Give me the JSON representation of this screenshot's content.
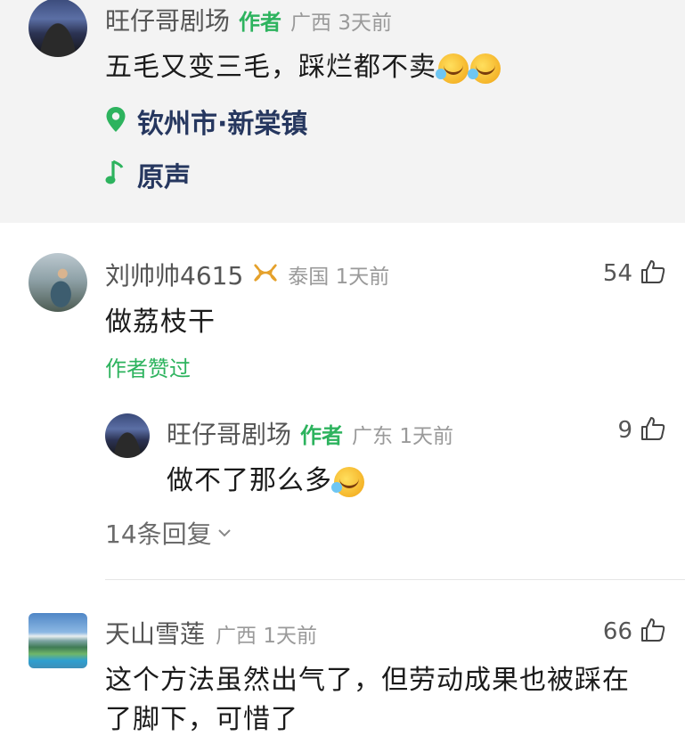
{
  "colors": {
    "author_green": "#2db35e",
    "location_blue": "#26375f",
    "post_background": "#f3f3f3"
  },
  "post": {
    "user": "旺仔哥剧场",
    "author_tag": "作者",
    "region_time": "广西 3天前",
    "text": "五毛又变三毛，踩烂都不卖",
    "emojis": [
      "crying-laughing",
      "crying-laughing"
    ],
    "location_icon": "location-pin-icon",
    "location": "钦州市·新棠镇",
    "music_icon": "music-note-icon",
    "music": "原声"
  },
  "comments": [
    {
      "user": "刘帅帅4615",
      "badge_icon": "vip-badge-icon",
      "region_time": "泰国 1天前",
      "likes": "54",
      "text": "做荔枝干",
      "author_liked": "作者赞过",
      "reply": {
        "user": "旺仔哥剧场",
        "author_tag": "作者",
        "region_time": "广东 1天前",
        "likes": "9",
        "text": "做不了那么多",
        "emoji": "crying-laughing"
      },
      "more_replies": "14条回复"
    },
    {
      "user": "天山雪莲",
      "region_time": "广西 1天前",
      "likes": "66",
      "text_line1": "这个方法虽然出气了，但劳动成果也被踩在",
      "text_line2": "了脚下，可惜了"
    }
  ]
}
